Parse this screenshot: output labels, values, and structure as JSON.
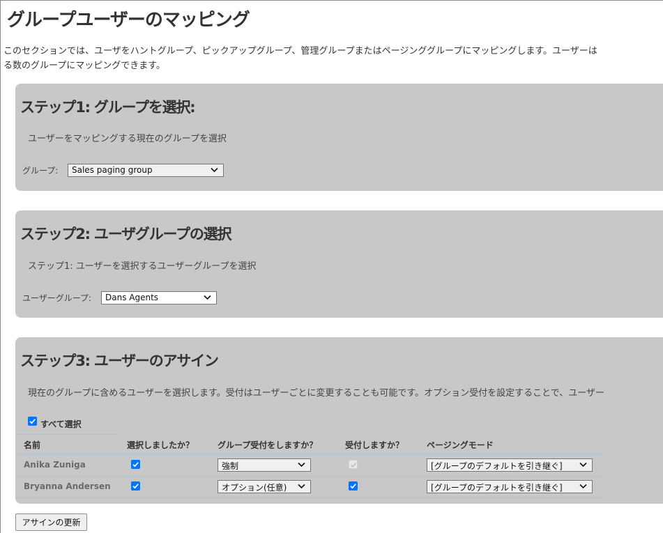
{
  "page": {
    "title": "グループユーザーのマッピング",
    "intro_line1": "このセクションでは、ユーザをハントグループ、ピックアップグループ、管理グループまたはページンググループにマッピングします。ユーザーは",
    "intro_line2": "る数のグループにマッピングできます。"
  },
  "step1": {
    "heading": "ステップ1: グループを選択:",
    "description": "ユーザーをマッピングする現在のグループを選択",
    "group_label": "グループ:",
    "group_value": "Sales paging group"
  },
  "step2": {
    "heading": "ステップ2: ユーザグループの選択",
    "description": "ステップ1: ユーザーを選択するユーザーグループを選択",
    "usergroup_label": "ユーザーグループ:",
    "usergroup_value": "Dans Agents"
  },
  "step3": {
    "heading": "ステップ3: ユーザーのアサイン",
    "description": "現在のグループに含めるユーザーを選択します。受付はユーザーごとに変更することも可能です。オプション受付を設定することで、ユーザー",
    "select_all_label": "すべて選択",
    "select_all_checked": true,
    "columns": {
      "name": "名前",
      "selected": "選択しましたか？",
      "group_answer": "グループ受付をしますか？",
      "answer": "受付しますか？",
      "paging_mode": "ページングモード"
    },
    "rows": [
      {
        "name": "Anika Zuniga",
        "selected": true,
        "group_answer": "強制",
        "answer": true,
        "answer_disabled": true,
        "paging_mode": "[グループのデフォルトを引き継ぐ]"
      },
      {
        "name": "Bryanna Andersen",
        "selected": true,
        "group_answer": "オプション(任意)",
        "answer": true,
        "answer_disabled": false,
        "paging_mode": "[グループのデフォルトを引き継ぐ]"
      }
    ]
  },
  "actions": {
    "update_label": "アサインの更新"
  },
  "colors": {
    "panel_bg": "#c8c8c8",
    "checkbox_accent": "#0075ff",
    "row_rule": "#a9c4d6"
  }
}
